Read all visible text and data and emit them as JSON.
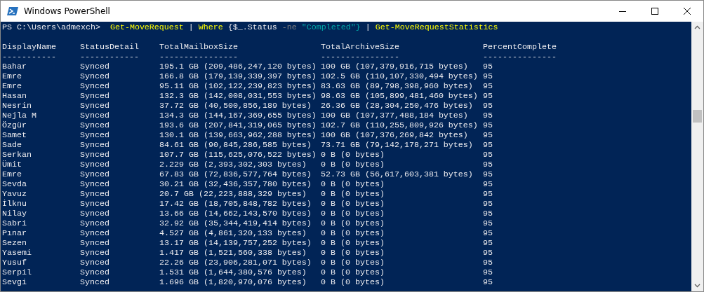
{
  "window": {
    "title": "Windows PowerShell"
  },
  "command_line": [
    {
      "kind": "prompt",
      "text": "PS C:\\Users\\admexch>"
    },
    {
      "kind": "cmdlet",
      "text": "Get-MoveRequest"
    },
    {
      "kind": "plain",
      "text": "|"
    },
    {
      "kind": "cmdlet",
      "text": "Where"
    },
    {
      "kind": "plain",
      "text": "{$_.Status"
    },
    {
      "kind": "operator",
      "text": "-ne"
    },
    {
      "kind": "string",
      "text": "\"Completed\"}"
    },
    {
      "kind": "plain",
      "text": "|"
    },
    {
      "kind": "cmdlet",
      "text": "Get-MoveRequestStatistics"
    }
  ],
  "table": {
    "columns": [
      {
        "heading": "DisplayName",
        "rule": "-----------"
      },
      {
        "heading": "StatusDetail",
        "rule": "------------"
      },
      {
        "heading": "TotalMailboxSize",
        "rule": "----------------"
      },
      {
        "heading": "TotalArchiveSize",
        "rule": "----------------"
      },
      {
        "heading": "PercentComplete",
        "rule": "---------------"
      }
    ],
    "rows": [
      [
        "Bahar",
        "Synced",
        "195.1 GB (209,486,247,120 bytes)",
        "100 GB (107,379,916,715 bytes)",
        "95"
      ],
      [
        "Emre",
        "Synced",
        "166.8 GB (179,139,339,397 bytes)",
        "102.5 GB (110,107,330,494 bytes)",
        "95"
      ],
      [
        "Emre",
        "Synced",
        "95.11 GB (102,122,239,823 bytes)",
        "83.63 GB (89,798,398,960 bytes)",
        "95"
      ],
      [
        "Hasan",
        "Synced",
        "132.3 GB (142,008,031,553 bytes)",
        "98.63 GB (105,899,481,460 bytes)",
        "95"
      ],
      [
        "Nesrin",
        "Synced",
        "37.72 GB (40,500,856,189 bytes)",
        "26.36 GB (28,304,250,476 bytes)",
        "95"
      ],
      [
        "Nejla M",
        "Synced",
        "134.3 GB (144,167,369,655 bytes)",
        "100 GB (107,377,488,184 bytes)",
        "95"
      ],
      [
        "Özgür",
        "Synced",
        "193.6 GB (207,841,319,065 bytes)",
        "102.7 GB (110,255,809,926 bytes)",
        "95"
      ],
      [
        "Samet",
        "Synced",
        "130.1 GB (139,663,962,288 bytes)",
        "100 GB (107,376,269,842 bytes)",
        "95"
      ],
      [
        "Sade",
        "Synced",
        "84.61 GB (90,845,286,585 bytes)",
        "73.71 GB (79,142,178,271 bytes)",
        "95"
      ],
      [
        "Serkan",
        "Synced",
        "107.7 GB (115,625,076,522 bytes)",
        "0 B (0 bytes)",
        "95"
      ],
      [
        "Ümit",
        "Synced",
        "2.229 GB (2,393,302,303 bytes)",
        "0 B (0 bytes)",
        "95"
      ],
      [
        "Emre",
        "Synced",
        "67.83 GB (72,836,577,764 bytes)",
        "52.73 GB (56,617,603,381 bytes)",
        "95"
      ],
      [
        "Sevda",
        "Synced",
        "30.21 GB (32,436,357,780 bytes)",
        "0 B (0 bytes)",
        "95"
      ],
      [
        "Yavuz",
        "Synced",
        "20.7 GB (22,223,888,329 bytes)",
        "0 B (0 bytes)",
        "95"
      ],
      [
        "İlknu",
        "Synced",
        "17.42 GB (18,705,848,782 bytes)",
        "0 B (0 bytes)",
        "95"
      ],
      [
        "Nilay",
        "Synced",
        "13.66 GB (14,662,143,570 bytes)",
        "0 B (0 bytes)",
        "95"
      ],
      [
        "Sabri",
        "Synced",
        "32.92 GB (35,344,419,414 bytes)",
        "0 B (0 bytes)",
        "95"
      ],
      [
        "Pınar",
        "Synced",
        "4.527 GB (4,861,320,133 bytes)",
        "0 B (0 bytes)",
        "95"
      ],
      [
        "Sezen",
        "Synced",
        "13.17 GB (14,139,757,252 bytes)",
        "0 B (0 bytes)",
        "95"
      ],
      [
        "Yasemi",
        "Synced",
        "1.417 GB (1,521,560,338 bytes)",
        "0 B (0 bytes)",
        "95"
      ],
      [
        "Yusuf",
        "Synced",
        "22.26 GB (23,906,281,071 bytes)",
        "0 B (0 bytes)",
        "95"
      ],
      [
        "Serpil",
        "Synced",
        "1.531 GB (1,644,380,576 bytes)",
        "0 B (0 bytes)",
        "95"
      ],
      [
        "Sevgi",
        "Synced",
        "1.696 GB (1,820,970,076 bytes)",
        "0 B (0 bytes)",
        "95"
      ]
    ]
  }
}
